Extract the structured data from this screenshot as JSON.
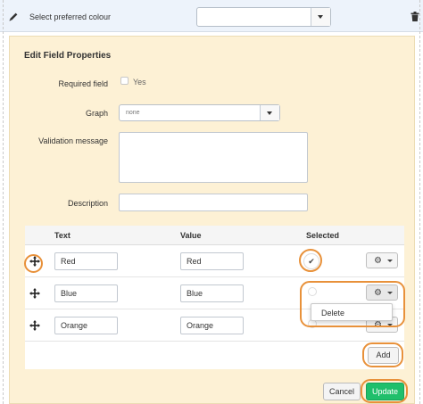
{
  "topbar": {
    "label": "Select preferred colour",
    "select_value": "",
    "icons": {
      "edit": "pencil-icon",
      "delete": "trash-icon"
    }
  },
  "panel": {
    "title": "Edit Field Properties",
    "required_label": "Required field",
    "required_option": "Yes",
    "required_checked": false,
    "graph_label": "Graph",
    "graph_value": "none",
    "validation_label": "Validation message",
    "validation_value": "",
    "description_label": "Description",
    "description_value": ""
  },
  "table": {
    "headers": {
      "text": "Text",
      "value": "Value",
      "selected": "Selected"
    },
    "rows": [
      {
        "text": "Red",
        "value": "Red",
        "selected": true
      },
      {
        "text": "Blue",
        "value": "Blue",
        "selected": false
      },
      {
        "text": "Orange",
        "value": "Orange",
        "selected": false
      }
    ],
    "row_menu": {
      "items": [
        "Delete"
      ]
    },
    "add_label": "Add"
  },
  "actions": {
    "cancel_label": "Cancel",
    "update_label": "Update"
  },
  "colors": {
    "topbar_bg": "#edf3fb",
    "panel_bg": "#fdf1d5",
    "highlight": "#e8913a",
    "update_button": "#1fbf6b"
  }
}
